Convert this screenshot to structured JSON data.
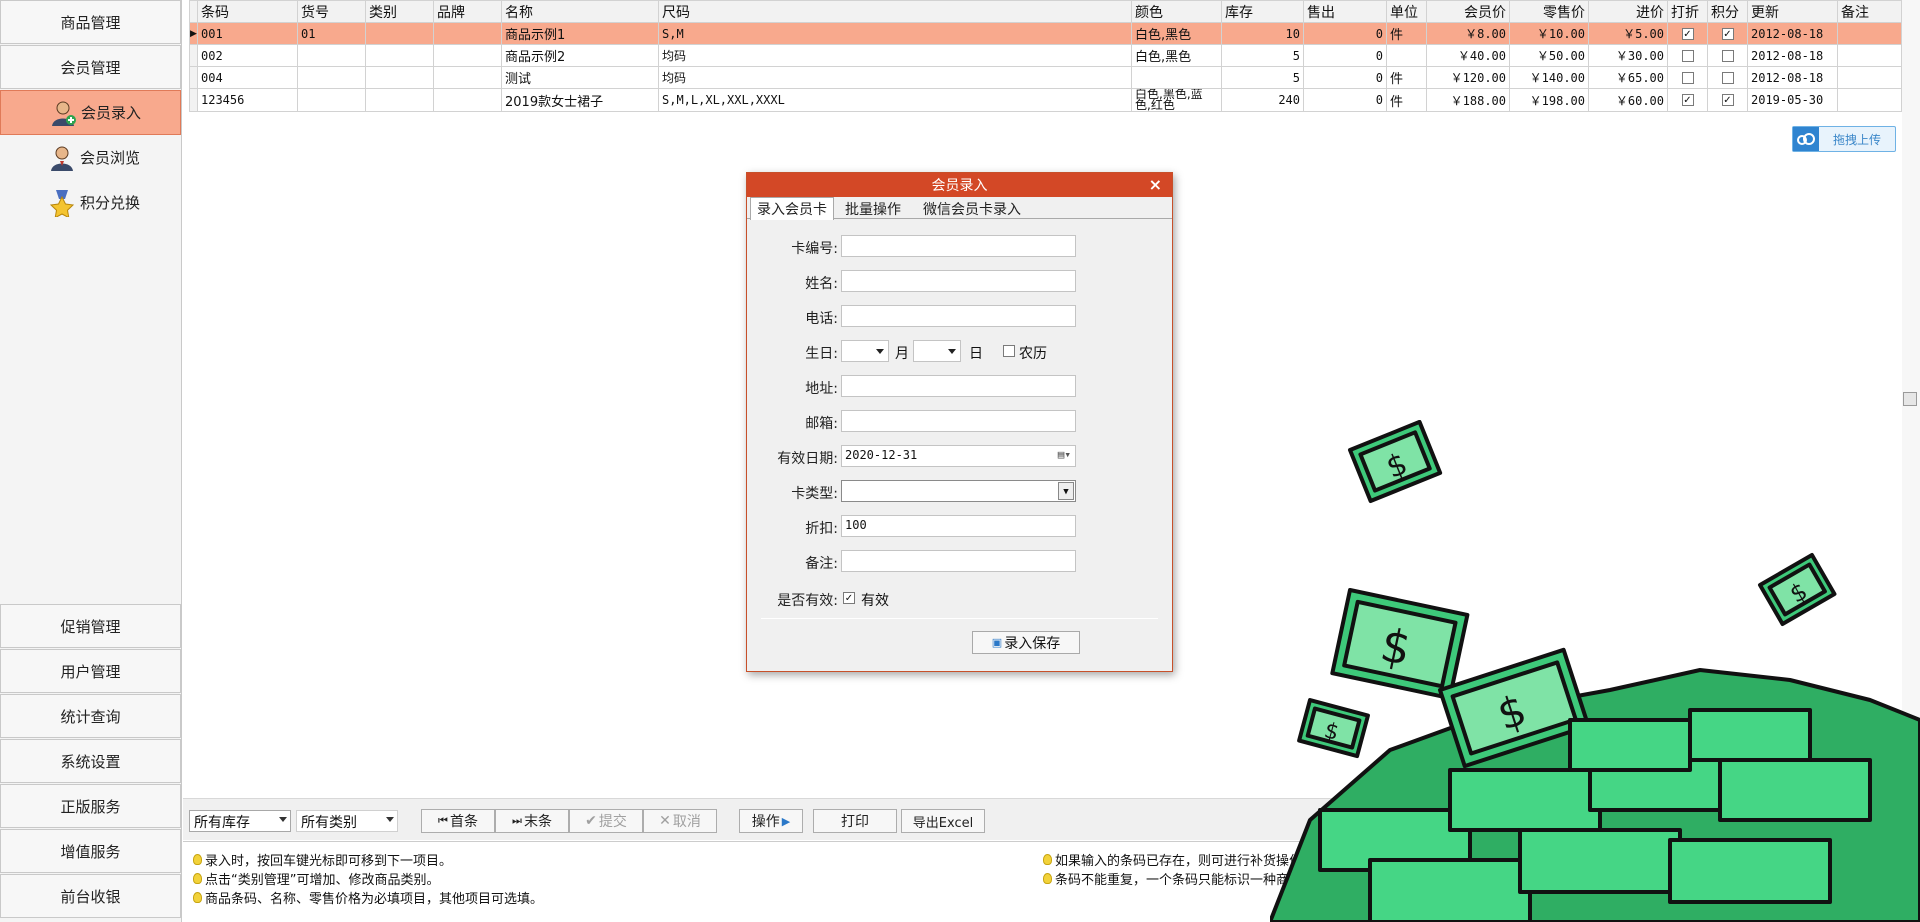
{
  "sidebar": {
    "top_items": [
      "商品管理",
      "会员管理"
    ],
    "sub_items": [
      {
        "label": "会员录入",
        "icon": "user-add-icon",
        "active": true
      },
      {
        "label": "会员浏览",
        "icon": "user-icon",
        "active": false
      },
      {
        "label": "积分兑换",
        "icon": "star-medal-icon",
        "active": false
      }
    ],
    "bottom_items": [
      "促销管理",
      "用户管理",
      "统计查询",
      "系统设置",
      "正版服务",
      "增值服务",
      "前台收银"
    ]
  },
  "grid": {
    "columns": [
      "条码",
      "货号",
      "类别",
      "品牌",
      "名称",
      "尺码",
      "颜色",
      "库存",
      "售出",
      "单位",
      "会员价",
      "零售价",
      "进价",
      "打折",
      "积分",
      "更新",
      "备注"
    ],
    "rows": [
      {
        "barcode": "001",
        "sku": "01",
        "category": "",
        "brand": "",
        "name": "商品示例1",
        "size": "S,M",
        "color": "白色,黑色",
        "stock": "10",
        "sold": "0",
        "unit": "件",
        "member_price": "￥8.00",
        "retail_price": "￥10.00",
        "cost": "￥5.00",
        "discount": true,
        "points": true,
        "updated": "2012-08-18",
        "note": ""
      },
      {
        "barcode": "002",
        "sku": "",
        "category": "",
        "brand": "",
        "name": "商品示例2",
        "size": "均码",
        "color": "白色,黑色",
        "stock": "5",
        "sold": "0",
        "unit": "",
        "member_price": "￥40.00",
        "retail_price": "￥50.00",
        "cost": "￥30.00",
        "discount": false,
        "points": false,
        "updated": "2012-08-18",
        "note": ""
      },
      {
        "barcode": "004",
        "sku": "",
        "category": "",
        "brand": "",
        "name": "测试",
        "size": "均码",
        "color": "",
        "stock": "5",
        "sold": "0",
        "unit": "件",
        "member_price": "￥120.00",
        "retail_price": "￥140.00",
        "cost": "￥65.00",
        "discount": false,
        "points": false,
        "updated": "2012-08-18",
        "note": ""
      },
      {
        "barcode": "123456",
        "sku": "",
        "category": "",
        "brand": "",
        "name": "2019款女士裙子",
        "size": "S,M,L,XL,XXL,XXXL",
        "color": "白色,黑色,蓝色,红色",
        "stock": "240",
        "sold": "0",
        "unit": "件",
        "member_price": "￥188.00",
        "retail_price": "￥198.00",
        "cost": "￥60.00",
        "discount": true,
        "points": true,
        "updated": "2019-05-30",
        "note": ""
      }
    ]
  },
  "upload_button": "拖拽上传",
  "toolbar": {
    "stock_filter": "所有库存",
    "category_filter": "所有类别",
    "first": "首条",
    "last": "末条",
    "submit": "提交",
    "cancel": "取消",
    "operate": "操作",
    "print": "打印",
    "export": "导出Excel"
  },
  "tips": [
    "录入时，按回车键光标即可移到下一项目。",
    "点击“类别管理”可增加、修改商品类别。",
    "商品条码、名称、零售价格为必填项目，其他项目可选填。",
    "如果输入的条码已存在，则可进行补货操作。",
    "条码不能重复，一个条码只能标识一种商品。"
  ],
  "dialog": {
    "title": "会员录入",
    "tabs": [
      "录入会员卡",
      "批量操作",
      "微信会员卡录入"
    ],
    "labels": {
      "card_no": "卡编号:",
      "name": "姓名:",
      "phone": "电话:",
      "birthday": "生日:",
      "month": "月",
      "day": "日",
      "lunar": "农历",
      "address": "地址:",
      "email": "邮箱:",
      "expiry": "有效日期:",
      "card_type": "卡类型:",
      "discount": "折扣:",
      "note": "备注:",
      "valid": "是否有效:",
      "valid_checkbox": "有效"
    },
    "values": {
      "card_no": "",
      "name": "",
      "phone": "",
      "address": "",
      "email": "",
      "expiry": "2020-12-31",
      "card_type": "",
      "discount": "100",
      "note": "",
      "lunar": false,
      "valid": true
    },
    "save_button": "录入保存"
  },
  "colors": {
    "selected_row": "#f8a98d",
    "dialog_title": "#d34826",
    "money_green": "#3ec97a"
  }
}
